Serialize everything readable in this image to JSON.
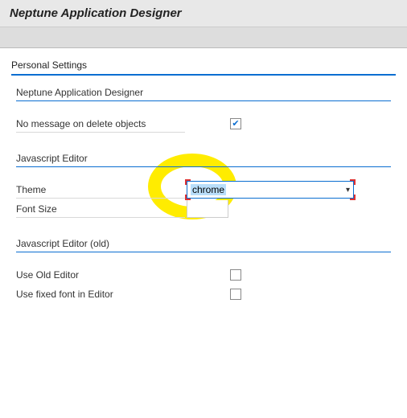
{
  "header": {
    "title": "Neptune Application Designer"
  },
  "section": {
    "title": "Personal Settings"
  },
  "groups": {
    "designer": {
      "label": "Neptune Application Designer",
      "noMessageLabel": "No message on delete objects",
      "noMessageChecked": true
    },
    "jsEditor": {
      "label": "Javascript Editor",
      "themeLabel": "Theme",
      "themeValue": "chrome",
      "fontSizeLabel": "Font Size"
    },
    "jsEditorOld": {
      "label": "Javascript Editor (old)",
      "useOldLabel": "Use Old Editor",
      "useOldChecked": false,
      "useFixedLabel": "Use fixed font in Editor",
      "useFixedChecked": false
    }
  }
}
